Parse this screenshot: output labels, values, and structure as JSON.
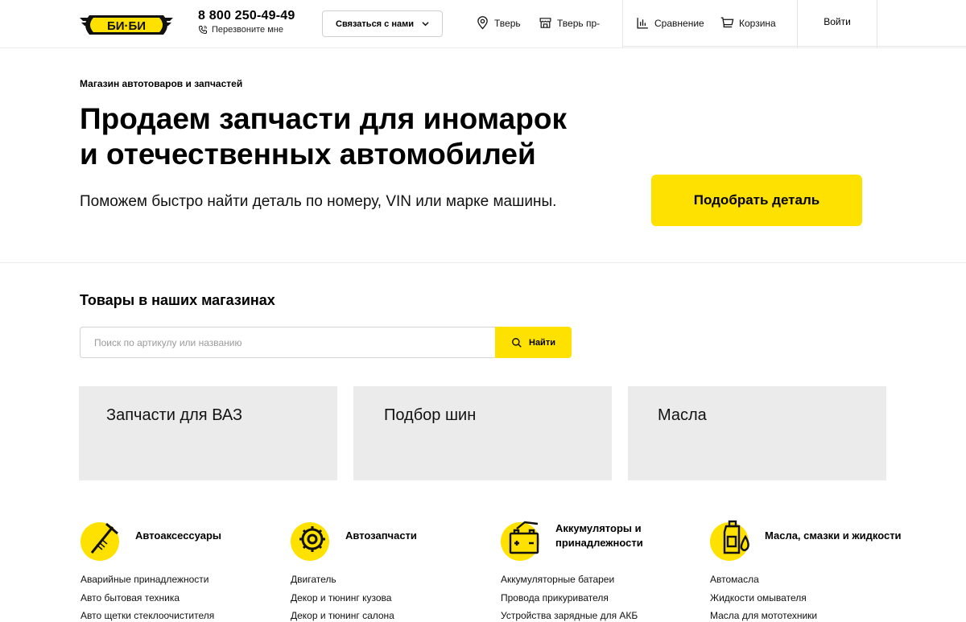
{
  "header": {
    "logo_text": "БИ·БИ",
    "phone": "8 800 250-49-49",
    "callback": "Перезвоните мне",
    "contact_button": "Связаться с нами",
    "city": "Тверь",
    "store": "Тверь пр-",
    "compare": "Сравнение",
    "cart": "Корзина",
    "login": "Войти"
  },
  "hero": {
    "eyebrow": "Магазин автотоваров и запчастей",
    "title_line1": "Продаем запчасти для иномарок",
    "title_line2": "и отечественных автомобилей",
    "subtitle": "Поможем быстро найти деталь по номеру, VIN или марке машины.",
    "cta": "Подобрать деталь"
  },
  "search": {
    "title": "Товары в наших магазинах",
    "placeholder": "Поиск по артикулу или названию",
    "button": "Найти"
  },
  "tiles": [
    "Запчасти для ВАЗ",
    "Подбор шин",
    "Масла"
  ],
  "categories": [
    {
      "title": "Автоаксессуары",
      "icon": "wiper-icon",
      "links": [
        "Аварийные принадлежности",
        "Авто бытовая техника",
        "Авто щетки стеклоочистителя"
      ]
    },
    {
      "title": "Автозапчасти",
      "icon": "gear-icon",
      "links": [
        "Двигатель",
        "Декор и тюнинг кузова",
        "Декор и тюнинг салона"
      ]
    },
    {
      "title": "Аккумуляторы и принадлежности",
      "icon": "battery-icon",
      "links": [
        "Аккумуляторные батареи",
        "Провода прикуривателя",
        "Устройства зарядные для АКБ"
      ]
    },
    {
      "title": "Масла, смазки и жидкости",
      "icon": "oil-can-icon",
      "links": [
        "Автомасла",
        "Жидкости омывателя",
        "Масла для мототехники"
      ]
    }
  ],
  "colors": {
    "accent": "#ffe100",
    "tile_bg": "#ebebeb"
  }
}
